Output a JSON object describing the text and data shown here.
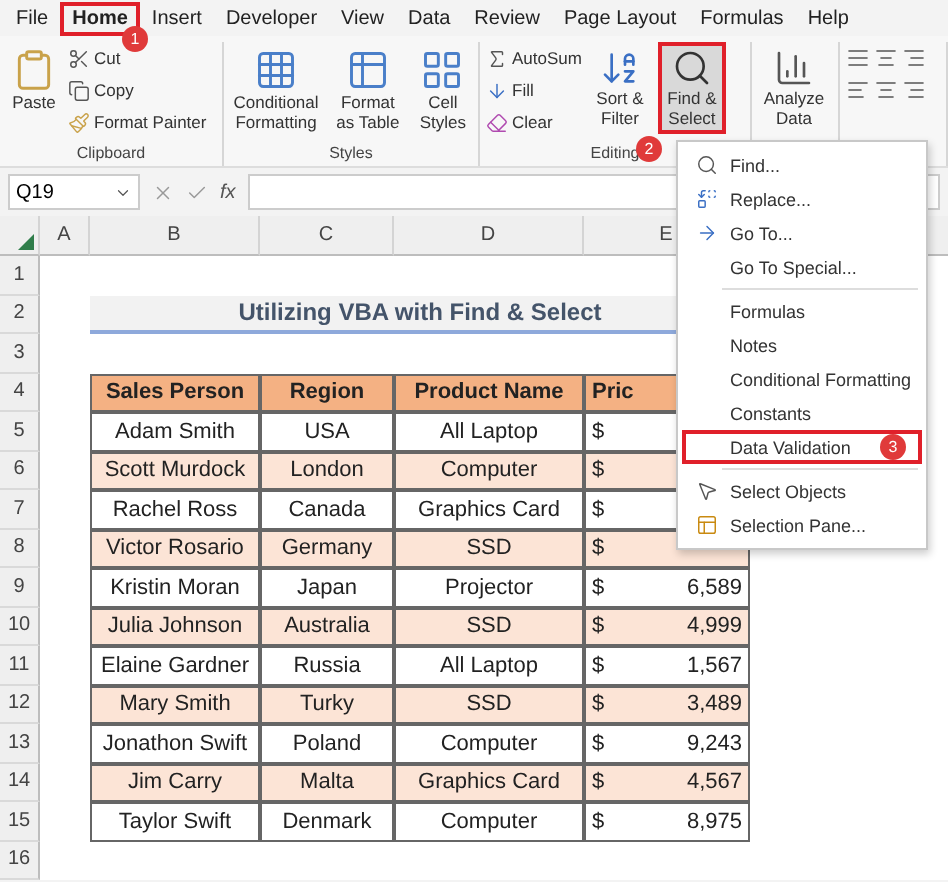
{
  "menu_tabs": [
    {
      "label": "File",
      "selected": false,
      "highlighted": false
    },
    {
      "label": "Home",
      "selected": true,
      "highlighted": true,
      "badge": "1"
    },
    {
      "label": "Insert",
      "selected": false,
      "highlighted": false
    },
    {
      "label": "Developer",
      "selected": false,
      "highlighted": false
    },
    {
      "label": "View",
      "selected": false,
      "highlighted": false
    },
    {
      "label": "Data",
      "selected": false,
      "highlighted": false
    },
    {
      "label": "Review",
      "selected": false,
      "highlighted": false
    },
    {
      "label": "Page Layout",
      "selected": false,
      "highlighted": false
    },
    {
      "label": "Formulas",
      "selected": false,
      "highlighted": false
    },
    {
      "label": "Help",
      "selected": false,
      "highlighted": false
    }
  ],
  "clipboard": {
    "paste": "Paste",
    "cut": "Cut",
    "copy": "Copy",
    "format_painter": "Format Painter",
    "label": "Clipboard"
  },
  "styles": {
    "buttons": [
      "Conditional Formatting",
      "Format as Table",
      "Cell Styles"
    ],
    "label": "Styles"
  },
  "editing": {
    "autosum": "AutoSum",
    "fill": "Fill",
    "clear": "Clear",
    "sort_filter": "Sort & Filter",
    "find_select": {
      "label": "Find & Select",
      "highlighted": true,
      "badge": "2"
    },
    "label": "Editing"
  },
  "analyze": {
    "label": "Analyze Data"
  },
  "formula_bar": {
    "name_box": "Q19",
    "fx": "fx"
  },
  "sheet": {
    "column_headers": [
      "A",
      "B",
      "C",
      "D",
      "E"
    ],
    "row_numbers": [
      "1",
      "2",
      "3",
      "4",
      "5",
      "6",
      "7",
      "8",
      "9",
      "10",
      "11",
      "12",
      "13",
      "14",
      "15",
      "16"
    ],
    "title": "Utilizing VBA with Find & Select",
    "table_header": [
      "Sales Person",
      "Region",
      "Product Name",
      "Pric"
    ],
    "rows": [
      {
        "sales_person": "Adam Smith",
        "region": "USA",
        "product": "All Laptop",
        "price": {
          "currency": "$"
        }
      },
      {
        "sales_person": "Scott Murdock",
        "region": "London",
        "product": "Computer",
        "price": {
          "currency": "$"
        }
      },
      {
        "sales_person": "Rachel Ross",
        "region": "Canada",
        "product": "Graphics Card",
        "price": {
          "currency": "$"
        }
      },
      {
        "sales_person": "Victor Rosario",
        "region": "Germany",
        "product": "SSD",
        "price": {
          "currency": "$"
        }
      },
      {
        "sales_person": "Kristin Moran",
        "region": "Japan",
        "product": "Projector",
        "price": {
          "currency": "$",
          "amount": "6,589"
        }
      },
      {
        "sales_person": "Julia Johnson",
        "region": "Australia",
        "product": "SSD",
        "price": {
          "currency": "$",
          "amount": "4,999"
        }
      },
      {
        "sales_person": "Elaine Gardner",
        "region": "Russia",
        "product": "All Laptop",
        "price": {
          "currency": "$",
          "amount": "1,567"
        }
      },
      {
        "sales_person": "Mary Smith",
        "region": "Turky",
        "product": "SSD",
        "price": {
          "currency": "$",
          "amount": "3,489"
        }
      },
      {
        "sales_person": "Jonathon Swift",
        "region": "Poland",
        "product": "Computer",
        "price": {
          "currency": "$",
          "amount": "9,243"
        }
      },
      {
        "sales_person": "Jim Carry",
        "region": "Malta",
        "product": "Graphics Card",
        "price": {
          "currency": "$",
          "amount": "4,567"
        }
      },
      {
        "sales_person": "Taylor Swift",
        "region": "Denmark",
        "product": "Computer",
        "price": {
          "currency": "$",
          "amount": "8,975"
        }
      }
    ]
  },
  "dropdown_menu": {
    "items": [
      {
        "label": "Find...",
        "kind": "find",
        "highlighted": false
      },
      {
        "label": "Replace...",
        "kind": "replace",
        "highlighted": false
      },
      {
        "label": "Go To...",
        "kind": "goto",
        "highlighted": false
      },
      {
        "label": "Go To Special...",
        "kind": "plain",
        "highlighted": false
      },
      {
        "kind": "separator"
      },
      {
        "label": "Formulas",
        "kind": "plain",
        "highlighted": false
      },
      {
        "label": "Notes",
        "kind": "plain",
        "highlighted": false
      },
      {
        "label": "Conditional Formatting",
        "kind": "plain",
        "highlighted": false
      },
      {
        "label": "Constants",
        "kind": "plain",
        "highlighted": false
      },
      {
        "label": "Data Validation",
        "kind": "plain",
        "highlighted": true,
        "badge": "3"
      },
      {
        "kind": "separator"
      },
      {
        "label": "Select Objects",
        "kind": "pointer",
        "highlighted": false
      },
      {
        "label": "Selection Pane...",
        "kind": "pane",
        "highlighted": false
      }
    ]
  }
}
